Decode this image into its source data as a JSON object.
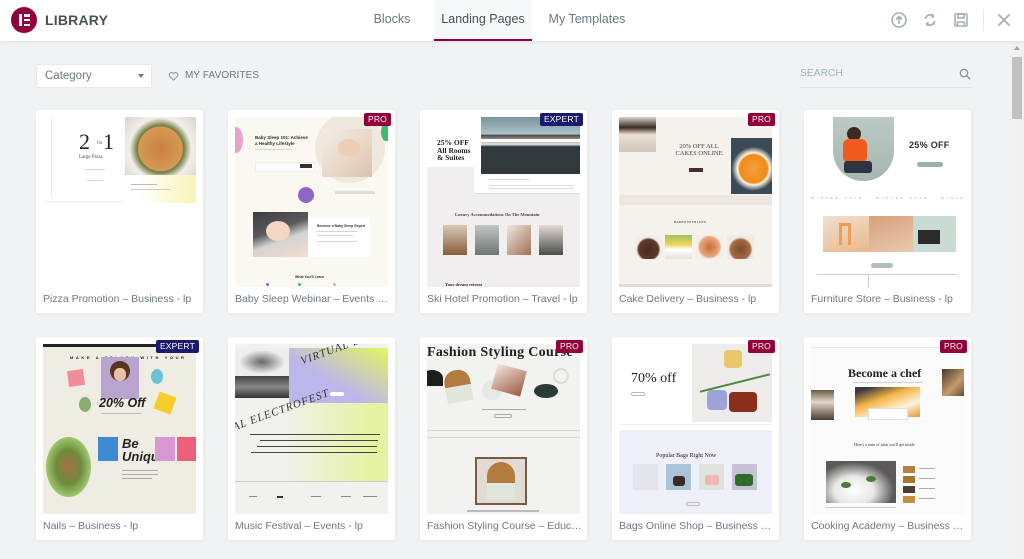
{
  "header": {
    "app_title": "LIBRARY",
    "logo_icon": "elementor-logo-icon",
    "tabs": [
      {
        "label": "Blocks",
        "active": false
      },
      {
        "label": "Landing Pages",
        "active": true
      },
      {
        "label": "My Templates",
        "active": false
      }
    ],
    "actions": [
      {
        "icon": "upload-icon",
        "label": "Import Template"
      },
      {
        "icon": "sync-icon",
        "label": "Sync Library"
      },
      {
        "icon": "save-icon",
        "label": "Save"
      },
      {
        "icon": "close-icon",
        "label": "Close"
      }
    ]
  },
  "toolbar": {
    "category_value": "Category",
    "favorites_label": "MY FAVORITES",
    "search_placeholder": "SEARCH"
  },
  "colors": {
    "brand": "#92003b",
    "pro_badge": "#92003b",
    "expert_badge": "#1c1a6f",
    "background": "#f1f2f3"
  },
  "templates": [
    {
      "title": "Pizza Promotion – Business - lp",
      "badge": null,
      "thumb": {
        "headline": "2",
        "sub": "Large Pizza"
      }
    },
    {
      "title": "Baby Sleep Webinar – Events - lp",
      "badge": "PRO",
      "thumb": {
        "headline": "Baby Sleep 101: Achieve a Healthy Lifestyle",
        "sub": "Become a Baby Sleep Expert",
        "footer": "What You'll Learn"
      }
    },
    {
      "title": "Ski Hotel Promotion – Travel - lp",
      "badge": "EXPERT",
      "thumb": {
        "headline": "25% OFF All Rooms & Suites",
        "sub": "Luxury Accommodations On The Mountain",
        "footer": "Your dream retreat"
      }
    },
    {
      "title": "Cake Delivery – Business - lp",
      "badge": "PRO",
      "thumb": {
        "headline": "20% OFF ALL CAKES ONLINE",
        "sub": "BAKED WITH LOVE"
      }
    },
    {
      "title": "Furniture Store – Business - lp",
      "badge": null,
      "thumb": {
        "headline": "25% OFF",
        "sub": "WINTER SALE"
      }
    },
    {
      "title": "Nails – Business - lp",
      "badge": "EXPERT",
      "thumb": {
        "headline": "20% Off",
        "sub": "Be Unique",
        "top": "MAKE A SPLASH WITH YOUR"
      }
    },
    {
      "title": "Music Festival – Events - lp",
      "badge": null,
      "thumb": {
        "headline": "VIRTUAL ELECTROFEST",
        "sub": "AL ELECTROFEST"
      }
    },
    {
      "title": "Fashion Styling Course – Educati...",
      "badge": "PRO",
      "thumb": {
        "headline": "Fashion Styling Course"
      }
    },
    {
      "title": "Bags Online Shop – Business - lp",
      "badge": "PRO",
      "thumb": {
        "headline": "70% off",
        "sub": "Popular Bags Right Now"
      }
    },
    {
      "title": "Cooking Academy – Business - lp",
      "badge": "PRO",
      "thumb": {
        "headline": "Become a chef",
        "sub": "Here's a taste of what you'll get inside"
      }
    }
  ]
}
